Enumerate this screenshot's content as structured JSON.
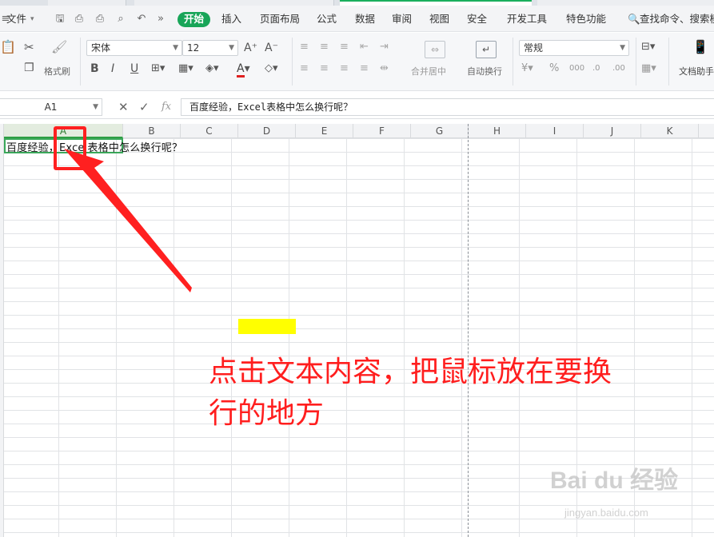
{
  "menu": {
    "file_label": "文件",
    "tabs": [
      "开始",
      "插入",
      "页面布局",
      "公式",
      "数据",
      "审阅",
      "视图",
      "安全",
      "开发工具",
      "特色功能"
    ],
    "active_tab": "开始",
    "search_label": "查找命令、搜索模"
  },
  "ribbon": {
    "format_painter_label": "格式刷",
    "font_name": "宋体",
    "font_size": "12",
    "font_grow": "A⁺",
    "font_shrink": "A⁻",
    "bold": "B",
    "italic": "I",
    "underline": "U",
    "merge_center_label": "合并居中",
    "wrap_text_label": "自动换行",
    "number_format": "常规",
    "doc_helper_label": "文档助手",
    "font_color": "#e02020"
  },
  "formula_bar": {
    "cell_ref": "A1",
    "fx_label": "fx",
    "content": "百度经验，Excel表格中怎么换行呢？"
  },
  "sheet": {
    "columns": [
      "A",
      "B",
      "C",
      "D",
      "E",
      "F",
      "G",
      "H",
      "I",
      "J",
      "K"
    ],
    "selected_column": "A",
    "cell_A1_text": "百度经验，Excel表格中怎么换行呢？",
    "highlight_color": "#ffff00"
  },
  "annotation": {
    "line1": "点击文本内容，把鼠标放在要换",
    "line2": "行的地方",
    "color": "#ff1e1e"
  },
  "watermark": {
    "brand": "Bai du 经验",
    "url": "jingyan.baidu.com"
  }
}
